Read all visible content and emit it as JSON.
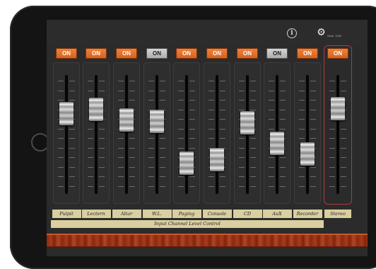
{
  "topbar": {
    "info_icon": "i",
    "gear_icon": "⚙",
    "gear_label": "Gear: 1234"
  },
  "channels": [
    {
      "name": "Pulpit",
      "button": "ON",
      "state": "on",
      "level": 0.72
    },
    {
      "name": "Lectern",
      "button": "ON",
      "state": "on",
      "level": 0.76
    },
    {
      "name": "Altar",
      "button": "ON",
      "state": "on",
      "level": 0.65
    },
    {
      "name": "W.L.",
      "button": "ON",
      "state": "off",
      "level": 0.64
    },
    {
      "name": "Paging",
      "button": "ON",
      "state": "on",
      "level": 0.2
    },
    {
      "name": "Console",
      "button": "ON",
      "state": "on",
      "level": 0.24
    },
    {
      "name": "CD",
      "button": "ON",
      "state": "on",
      "level": 0.62
    },
    {
      "name": "AuX",
      "button": "ON",
      "state": "off",
      "level": 0.41
    },
    {
      "name": "Recorder",
      "button": "ON",
      "state": "on",
      "level": 0.3
    }
  ],
  "stereo": {
    "name": "Stereo",
    "button": "ON",
    "state": "on",
    "level": 0.77
  },
  "caption": "Input Channel Level Control",
  "colors": {
    "on": "#e2712b",
    "off": "#c8c8c8",
    "stereo_frame": "#b03a3a",
    "label_bg": "#d9cfa0"
  }
}
